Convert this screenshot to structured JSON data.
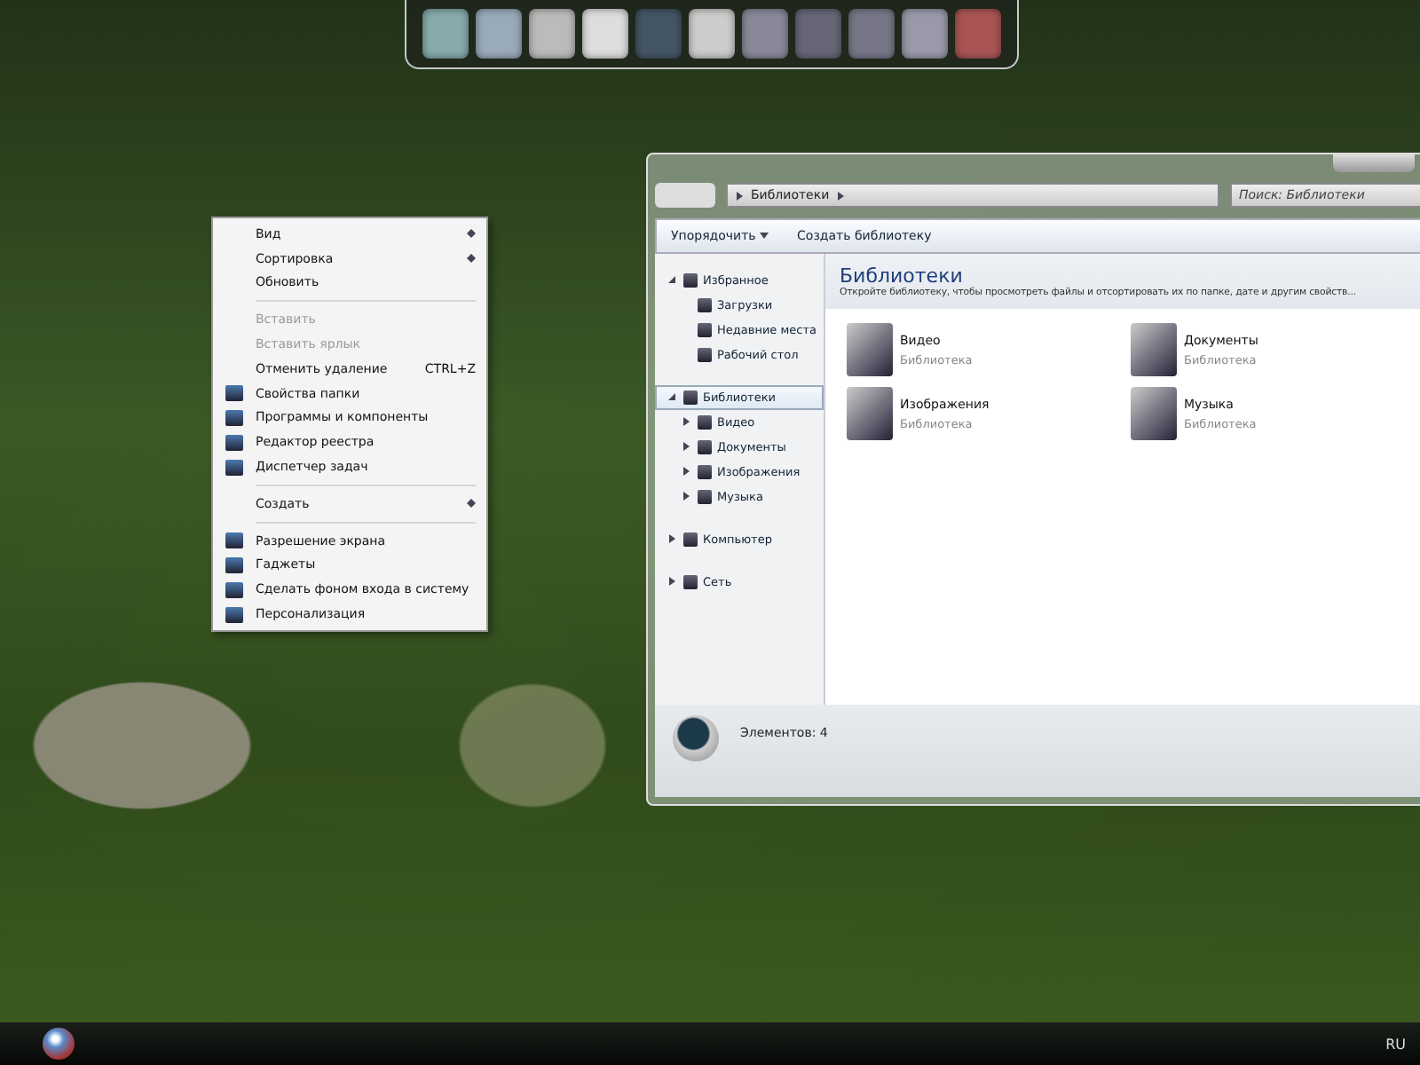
{
  "context_menu": {
    "items": [
      {
        "kind": "item",
        "label": "Вид",
        "submenu": true,
        "disabled": false,
        "icon": false
      },
      {
        "kind": "item",
        "label": "Сортировка",
        "submenu": true,
        "disabled": false,
        "icon": false
      },
      {
        "kind": "item",
        "label": "Обновить",
        "submenu": false,
        "disabled": false,
        "icon": false
      },
      {
        "kind": "separator"
      },
      {
        "kind": "item",
        "label": "Вставить",
        "submenu": false,
        "disabled": true,
        "icon": false
      },
      {
        "kind": "item",
        "label": "Вставить ярлык",
        "submenu": false,
        "disabled": true,
        "icon": false
      },
      {
        "kind": "item",
        "label": "Отменить удаление",
        "shortcut": "CTRL+Z",
        "submenu": false,
        "disabled": false,
        "icon": false
      },
      {
        "kind": "item",
        "label": "Свойства папки",
        "submenu": false,
        "disabled": false,
        "icon": true
      },
      {
        "kind": "item",
        "label": "Программы и компоненты",
        "submenu": false,
        "disabled": false,
        "icon": true
      },
      {
        "kind": "item",
        "label": "Редактор реестра",
        "submenu": false,
        "disabled": false,
        "icon": true
      },
      {
        "kind": "item",
        "label": "Диспетчер задач",
        "submenu": false,
        "disabled": false,
        "icon": true
      },
      {
        "kind": "separator"
      },
      {
        "kind": "item",
        "label": "Создать",
        "submenu": true,
        "disabled": false,
        "icon": false
      },
      {
        "kind": "separator"
      },
      {
        "kind": "item",
        "label": "Разрешение экрана",
        "submenu": false,
        "disabled": false,
        "icon": true
      },
      {
        "kind": "item",
        "label": "Гаджеты",
        "submenu": false,
        "disabled": false,
        "icon": true
      },
      {
        "kind": "item",
        "label": "Сделать фоном входа в систему",
        "submenu": false,
        "disabled": false,
        "icon": true
      },
      {
        "kind": "item",
        "label": "Персонализация",
        "submenu": false,
        "disabled": false,
        "icon": true
      }
    ]
  },
  "explorer": {
    "address": "Библиотеки",
    "search": {
      "placeholder": "Поиск: Библиотеки"
    },
    "toolbar": [
      {
        "label": "Упорядочить",
        "dropdown": true
      },
      {
        "label": "Создать библиотеку",
        "dropdown": false
      }
    ],
    "nav": [
      {
        "label": "Избранное",
        "expanded": true,
        "selected": false,
        "children": [
          {
            "label": "Загрузки"
          },
          {
            "label": "Недавние места"
          },
          {
            "label": "Рабочий стол"
          }
        ]
      },
      {
        "label": "Библиотеки",
        "expanded": true,
        "selected": true,
        "children": [
          {
            "label": "Видео",
            "expanded": false
          },
          {
            "label": "Документы",
            "expanded": false
          },
          {
            "label": "Изображения",
            "expanded": false
          },
          {
            "label": "Музыка",
            "expanded": false
          }
        ]
      },
      {
        "label": "Компьютер",
        "expanded": false,
        "selected": false
      },
      {
        "label": "Сеть",
        "expanded": false,
        "selected": false
      }
    ],
    "title": "Библиотеки",
    "description": "Откройте библиотеку, чтобы просмотреть файлы и отсортировать их по папке, дате и другим свойств...",
    "items": [
      {
        "name": "Видео",
        "type": "Библиотека"
      },
      {
        "name": "Документы",
        "type": "Библиотека"
      },
      {
        "name": "Изображения",
        "type": "Библиотека"
      },
      {
        "name": "Музыка",
        "type": "Библиотека"
      }
    ],
    "status": "Элементов: 4"
  },
  "taskbar": {
    "language": "RU"
  }
}
